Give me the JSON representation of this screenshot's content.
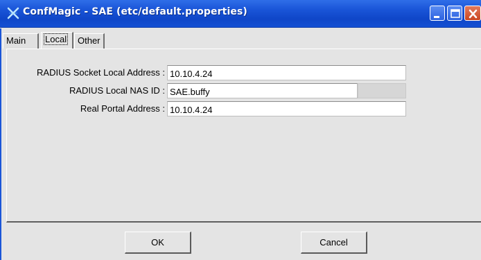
{
  "window": {
    "title": "ConfMagic - SAE (etc/default.properties)",
    "icons": {
      "app": "confmagic-x-icon",
      "minimize": "minimize-icon",
      "maximize": "maximize-icon",
      "close": "close-icon"
    },
    "colors": {
      "titlebar": "#1a55d8",
      "close_button": "#c9451f",
      "background": "#e4e4e4"
    }
  },
  "tabs": [
    {
      "label": "Main",
      "selected": false
    },
    {
      "label": "Local",
      "selected": true
    },
    {
      "label": "Other",
      "selected": false
    }
  ],
  "fields": {
    "radius_socket_local_address": {
      "label": "RADIUS Socket Local Address :",
      "value": "10.10.4.24"
    },
    "radius_local_nas_id": {
      "label": "RADIUS Local NAS ID :",
      "value": "SAE.buffy"
    },
    "real_portal_address": {
      "label": "Real Portal Address :",
      "value": "10.10.4.24"
    }
  },
  "buttons": {
    "ok": "OK",
    "cancel": "Cancel"
  }
}
